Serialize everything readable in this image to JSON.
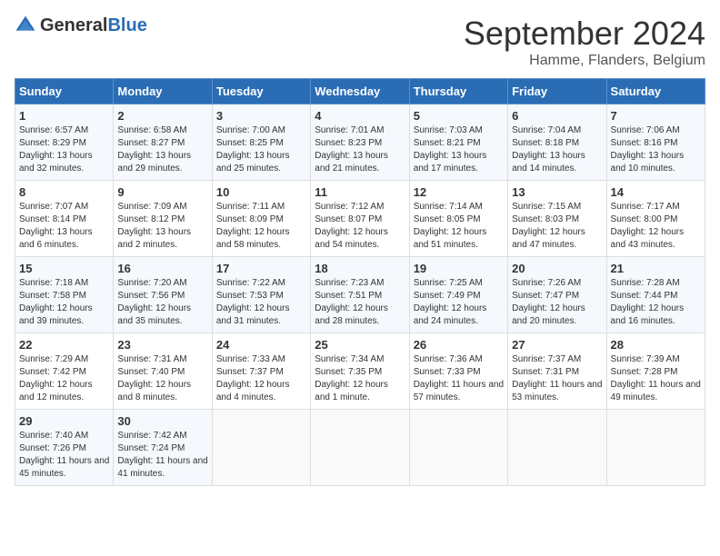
{
  "header": {
    "logo_general": "General",
    "logo_blue": "Blue",
    "month_title": "September 2024",
    "location": "Hamme, Flanders, Belgium"
  },
  "days_of_week": [
    "Sunday",
    "Monday",
    "Tuesday",
    "Wednesday",
    "Thursday",
    "Friday",
    "Saturday"
  ],
  "weeks": [
    [
      {
        "day": "1",
        "sunrise": "Sunrise: 6:57 AM",
        "sunset": "Sunset: 8:29 PM",
        "daylight": "Daylight: 13 hours and 32 minutes."
      },
      {
        "day": "2",
        "sunrise": "Sunrise: 6:58 AM",
        "sunset": "Sunset: 8:27 PM",
        "daylight": "Daylight: 13 hours and 29 minutes."
      },
      {
        "day": "3",
        "sunrise": "Sunrise: 7:00 AM",
        "sunset": "Sunset: 8:25 PM",
        "daylight": "Daylight: 13 hours and 25 minutes."
      },
      {
        "day": "4",
        "sunrise": "Sunrise: 7:01 AM",
        "sunset": "Sunset: 8:23 PM",
        "daylight": "Daylight: 13 hours and 21 minutes."
      },
      {
        "day": "5",
        "sunrise": "Sunrise: 7:03 AM",
        "sunset": "Sunset: 8:21 PM",
        "daylight": "Daylight: 13 hours and 17 minutes."
      },
      {
        "day": "6",
        "sunrise": "Sunrise: 7:04 AM",
        "sunset": "Sunset: 8:18 PM",
        "daylight": "Daylight: 13 hours and 14 minutes."
      },
      {
        "day": "7",
        "sunrise": "Sunrise: 7:06 AM",
        "sunset": "Sunset: 8:16 PM",
        "daylight": "Daylight: 13 hours and 10 minutes."
      }
    ],
    [
      {
        "day": "8",
        "sunrise": "Sunrise: 7:07 AM",
        "sunset": "Sunset: 8:14 PM",
        "daylight": "Daylight: 13 hours and 6 minutes."
      },
      {
        "day": "9",
        "sunrise": "Sunrise: 7:09 AM",
        "sunset": "Sunset: 8:12 PM",
        "daylight": "Daylight: 13 hours and 2 minutes."
      },
      {
        "day": "10",
        "sunrise": "Sunrise: 7:11 AM",
        "sunset": "Sunset: 8:09 PM",
        "daylight": "Daylight: 12 hours and 58 minutes."
      },
      {
        "day": "11",
        "sunrise": "Sunrise: 7:12 AM",
        "sunset": "Sunset: 8:07 PM",
        "daylight": "Daylight: 12 hours and 54 minutes."
      },
      {
        "day": "12",
        "sunrise": "Sunrise: 7:14 AM",
        "sunset": "Sunset: 8:05 PM",
        "daylight": "Daylight: 12 hours and 51 minutes."
      },
      {
        "day": "13",
        "sunrise": "Sunrise: 7:15 AM",
        "sunset": "Sunset: 8:03 PM",
        "daylight": "Daylight: 12 hours and 47 minutes."
      },
      {
        "day": "14",
        "sunrise": "Sunrise: 7:17 AM",
        "sunset": "Sunset: 8:00 PM",
        "daylight": "Daylight: 12 hours and 43 minutes."
      }
    ],
    [
      {
        "day": "15",
        "sunrise": "Sunrise: 7:18 AM",
        "sunset": "Sunset: 7:58 PM",
        "daylight": "Daylight: 12 hours and 39 minutes."
      },
      {
        "day": "16",
        "sunrise": "Sunrise: 7:20 AM",
        "sunset": "Sunset: 7:56 PM",
        "daylight": "Daylight: 12 hours and 35 minutes."
      },
      {
        "day": "17",
        "sunrise": "Sunrise: 7:22 AM",
        "sunset": "Sunset: 7:53 PM",
        "daylight": "Daylight: 12 hours and 31 minutes."
      },
      {
        "day": "18",
        "sunrise": "Sunrise: 7:23 AM",
        "sunset": "Sunset: 7:51 PM",
        "daylight": "Daylight: 12 hours and 28 minutes."
      },
      {
        "day": "19",
        "sunrise": "Sunrise: 7:25 AM",
        "sunset": "Sunset: 7:49 PM",
        "daylight": "Daylight: 12 hours and 24 minutes."
      },
      {
        "day": "20",
        "sunrise": "Sunrise: 7:26 AM",
        "sunset": "Sunset: 7:47 PM",
        "daylight": "Daylight: 12 hours and 20 minutes."
      },
      {
        "day": "21",
        "sunrise": "Sunrise: 7:28 AM",
        "sunset": "Sunset: 7:44 PM",
        "daylight": "Daylight: 12 hours and 16 minutes."
      }
    ],
    [
      {
        "day": "22",
        "sunrise": "Sunrise: 7:29 AM",
        "sunset": "Sunset: 7:42 PM",
        "daylight": "Daylight: 12 hours and 12 minutes."
      },
      {
        "day": "23",
        "sunrise": "Sunrise: 7:31 AM",
        "sunset": "Sunset: 7:40 PM",
        "daylight": "Daylight: 12 hours and 8 minutes."
      },
      {
        "day": "24",
        "sunrise": "Sunrise: 7:33 AM",
        "sunset": "Sunset: 7:37 PM",
        "daylight": "Daylight: 12 hours and 4 minutes."
      },
      {
        "day": "25",
        "sunrise": "Sunrise: 7:34 AM",
        "sunset": "Sunset: 7:35 PM",
        "daylight": "Daylight: 12 hours and 1 minute."
      },
      {
        "day": "26",
        "sunrise": "Sunrise: 7:36 AM",
        "sunset": "Sunset: 7:33 PM",
        "daylight": "Daylight: 11 hours and 57 minutes."
      },
      {
        "day": "27",
        "sunrise": "Sunrise: 7:37 AM",
        "sunset": "Sunset: 7:31 PM",
        "daylight": "Daylight: 11 hours and 53 minutes."
      },
      {
        "day": "28",
        "sunrise": "Sunrise: 7:39 AM",
        "sunset": "Sunset: 7:28 PM",
        "daylight": "Daylight: 11 hours and 49 minutes."
      }
    ],
    [
      {
        "day": "29",
        "sunrise": "Sunrise: 7:40 AM",
        "sunset": "Sunset: 7:26 PM",
        "daylight": "Daylight: 11 hours and 45 minutes."
      },
      {
        "day": "30",
        "sunrise": "Sunrise: 7:42 AM",
        "sunset": "Sunset: 7:24 PM",
        "daylight": "Daylight: 11 hours and 41 minutes."
      },
      null,
      null,
      null,
      null,
      null
    ]
  ]
}
